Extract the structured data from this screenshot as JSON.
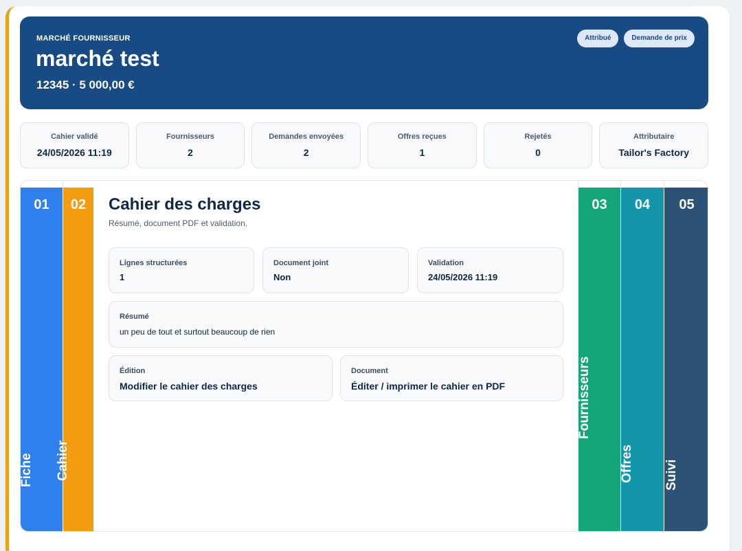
{
  "header": {
    "kicker": "MARCHÉ FOURNISSEUR",
    "title": "marché test",
    "subtitle": "12345 · 5 000,00 €",
    "badges": [
      "Attribué",
      "Demande de prix"
    ]
  },
  "stats": [
    {
      "label": "Cahier validé",
      "value": "24/05/2026 11:19"
    },
    {
      "label": "Fournisseurs",
      "value": "2"
    },
    {
      "label": "Demandes envoyées",
      "value": "2"
    },
    {
      "label": "Offres reçues",
      "value": "1"
    },
    {
      "label": "Rejetés",
      "value": "0"
    },
    {
      "label": "Attributaire",
      "value": "Tailor's Factory"
    }
  ],
  "tabs": [
    {
      "num": "01",
      "label": "Fiche",
      "color": "#2f7fec"
    },
    {
      "num": "02",
      "label": "Cahier",
      "color": "#f39c10"
    },
    {
      "num": "03",
      "label": "Fournisseurs",
      "color": "#14a679"
    },
    {
      "num": "04",
      "label": "Offres",
      "color": "#1396aa"
    },
    {
      "num": "05",
      "label": "Suivi",
      "color": "#2c5275"
    }
  ],
  "section": {
    "title": "Cahier des charges",
    "description": "Résumé, document PDF et validation.",
    "facts": [
      {
        "label": "Lignes structurées",
        "value": "1"
      },
      {
        "label": "Document joint",
        "value": "Non"
      },
      {
        "label": "Validation",
        "value": "24/05/2026 11:19"
      }
    ],
    "summary": {
      "label": "Résumé",
      "value": "un peu de tout et surtout beaucoup de rien"
    },
    "actions": [
      {
        "label": "Édition",
        "value": "Modifier le cahier des charges"
      },
      {
        "label": "Document",
        "value": "Éditer / imprimer le cahier en PDF"
      }
    ]
  }
}
